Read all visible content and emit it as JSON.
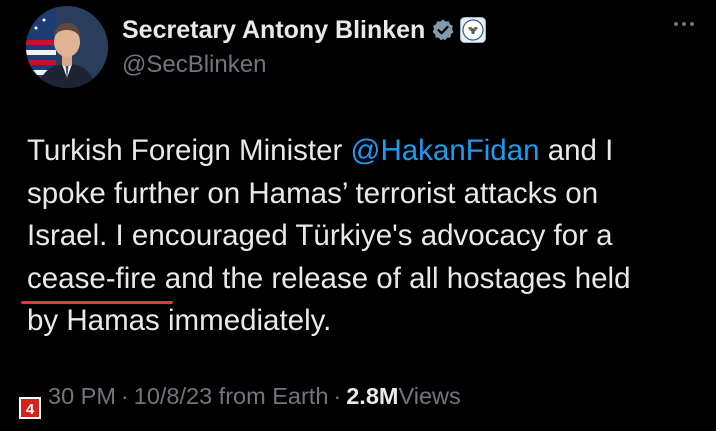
{
  "author": {
    "display_name": "Secretary Antony Blinken",
    "handle": "@SecBlinken",
    "avatar_icon": "profile-photo",
    "verified_icon": "verified-badge-icon",
    "affiliation_icon": "state-department-seal-icon"
  },
  "more_icon": "more-options-icon",
  "tweet": {
    "line1_before": "Turkish Foreign Minister ",
    "mention": "@HakanFidan",
    "line1_after": " and I",
    "line2": "spoke further on Hamas’ terrorist attacks on",
    "line3": "Israel. I encouraged Türkiye's advocacy for a",
    "line4_underlined": "cease-fire",
    "line4_after": " and the release of all hostages held",
    "line5": "by Hamas immediately."
  },
  "meta": {
    "time": "30 PM",
    "sep1": "·",
    "date": "10/8/23 from Earth",
    "sep2": "·",
    "views_count": "2.8M",
    "views_label": " Views"
  },
  "annotation": {
    "marker": "4"
  },
  "colors": {
    "background": "#000000",
    "text": "#e7e9ea",
    "secondary": "#71767b",
    "link": "#1d9bf0",
    "verified": "#829aab",
    "underline": "#e53935",
    "marker": "#d6221c"
  }
}
